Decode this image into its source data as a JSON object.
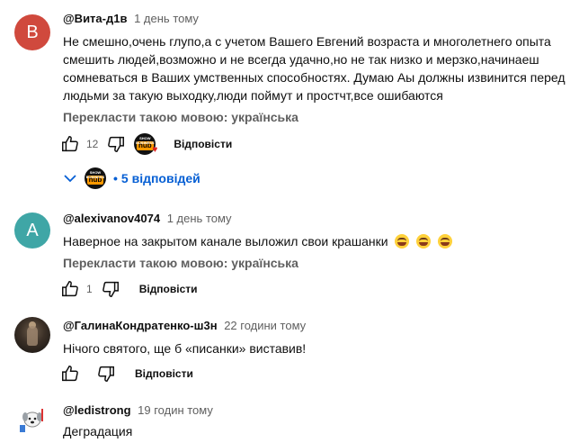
{
  "comments": [
    {
      "author": "@Вита-д1в",
      "time": "1 день тому",
      "avatar_letter": "В",
      "text": "Не смешно,очень глупо,а с учетом Вашего Евгений возраста и многолетнего опыта смешить людей,возможно и не всегда удачно,но не так низко и мерзко,начинаеш сомневаться в Ваших умственных способностях. Думаю Аы должны извинится перед людьми за такую выходку,люди поймут и простчт,все ошибаются",
      "translate": "Перекласти такою мовою: українська",
      "likes": "12",
      "reply_label": "Відповісти",
      "replies_label": "5 відповідей"
    },
    {
      "author": "@alexivanov4074",
      "time": "1 день тому",
      "avatar_letter": "A",
      "text": "Наверное на закрытом канале выложил свои крашанки",
      "translate": "Перекласти такою мовою: українська",
      "likes": "1",
      "reply_label": "Відповісти"
    },
    {
      "author": "@ГалинаКондратенко-ш3н",
      "time": "22 години тому",
      "text": "Нічого святого, ще б «писанки» виставив!",
      "reply_label": "Відповісти"
    },
    {
      "author": "@ledistrong",
      "time": "19 годин тому",
      "text": "Деградация"
    }
  ],
  "creator_badge": {
    "brand": "SHOW BUSINESS",
    "logo": "hub"
  },
  "icons": {
    "like": "thumb-up-icon",
    "dislike": "thumb-down-icon",
    "expand": "chevron-down-icon",
    "heart": "heart-icon"
  },
  "colors": {
    "link": "#065fd4",
    "muted": "#606060",
    "avatar_b": "#d0493d",
    "avatar_a": "#3fa6a6"
  }
}
